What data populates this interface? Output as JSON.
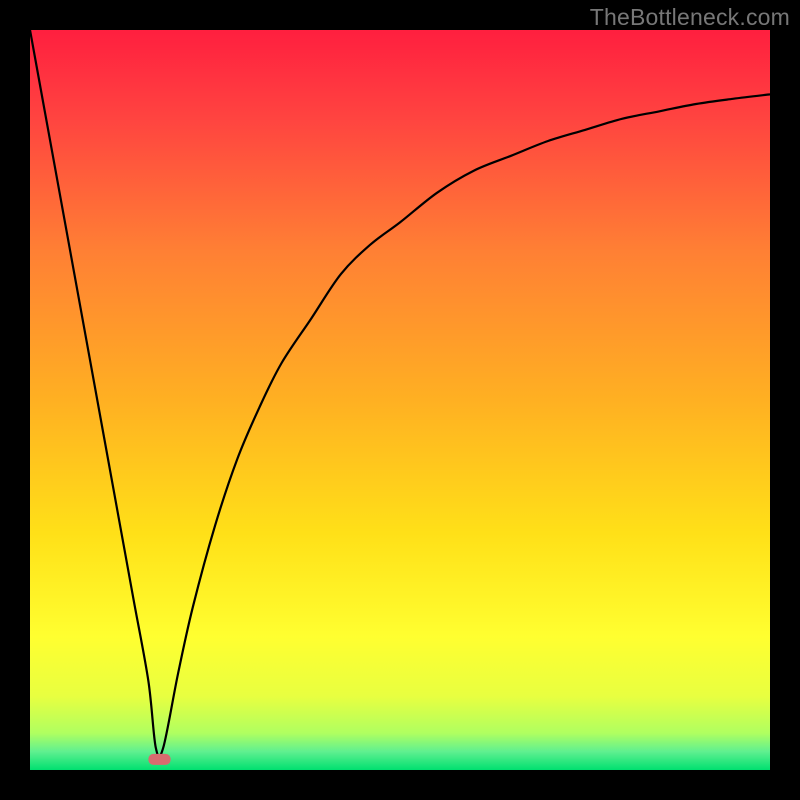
{
  "watermark": "TheBottleneck.com",
  "chart_data": {
    "type": "line",
    "title": "",
    "xlabel": "",
    "ylabel": "",
    "xlim": [
      0,
      100
    ],
    "ylim": [
      0,
      100
    ],
    "series": [
      {
        "name": "curve",
        "x": [
          0,
          2,
          4,
          6,
          8,
          10,
          12,
          14,
          16,
          17,
          18,
          20,
          22,
          25,
          28,
          31,
          34,
          38,
          42,
          46,
          50,
          55,
          60,
          65,
          70,
          75,
          80,
          85,
          90,
          95,
          100
        ],
        "values": [
          100,
          89,
          78,
          67,
          56,
          45,
          34,
          23,
          12,
          3,
          3,
          13,
          22,
          33,
          42,
          49,
          55,
          61,
          67,
          71,
          74,
          78,
          81,
          83,
          85,
          86.5,
          88,
          89,
          90,
          90.7,
          91.3
        ]
      }
    ],
    "marker": {
      "x_range": [
        16,
        19
      ],
      "y": 1.5,
      "color": "#d86b6f"
    },
    "background_gradient": {
      "type": "vertical",
      "stops": [
        {
          "pos": 0.0,
          "color": "#ff1f3f"
        },
        {
          "pos": 0.12,
          "color": "#ff4440"
        },
        {
          "pos": 0.3,
          "color": "#ff8034"
        },
        {
          "pos": 0.5,
          "color": "#ffb022"
        },
        {
          "pos": 0.68,
          "color": "#ffe018"
        },
        {
          "pos": 0.82,
          "color": "#ffff30"
        },
        {
          "pos": 0.9,
          "color": "#e8ff40"
        },
        {
          "pos": 0.95,
          "color": "#b0ff60"
        },
        {
          "pos": 0.975,
          "color": "#60f090"
        },
        {
          "pos": 1.0,
          "color": "#00e070"
        }
      ]
    }
  }
}
